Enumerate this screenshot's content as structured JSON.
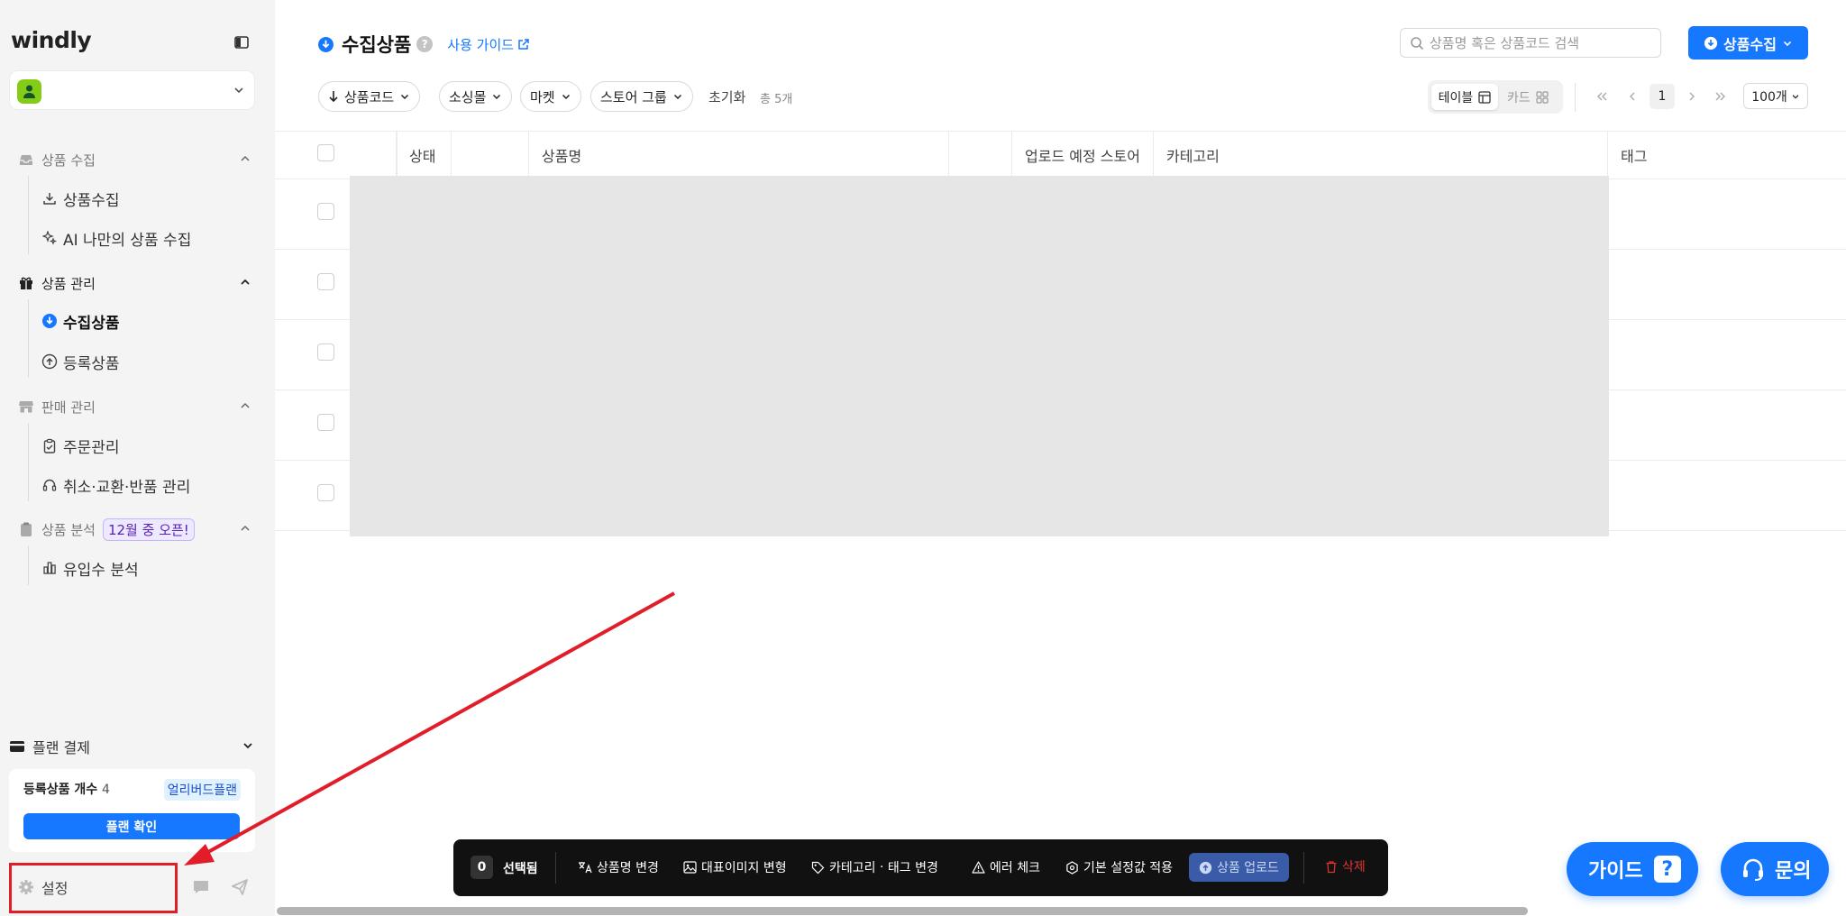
{
  "app": {
    "brand": "windly"
  },
  "sidebar": {
    "sections": [
      {
        "label": "상품 수집",
        "items": [
          {
            "label": "상품수집"
          },
          {
            "label": "AI 나만의 상품 수집"
          }
        ]
      },
      {
        "label": "상품 관리",
        "items": [
          {
            "label": "수집상품"
          },
          {
            "label": "등록상품"
          }
        ]
      },
      {
        "label": "판매 관리",
        "items": [
          {
            "label": "주문관리"
          },
          {
            "label": "취소·교환·반품 관리"
          }
        ]
      },
      {
        "label": "상품 분석",
        "badge": "12월 중 오픈!",
        "items": [
          {
            "label": "유입수 분석"
          }
        ]
      }
    ],
    "active_item": "수집상품",
    "plan": {
      "header": "플랜 결제",
      "count_label": "등록상품 개수",
      "count_value": "4",
      "plan_badge": "얼리버드플랜",
      "button": "플랜 확인"
    },
    "settings_label": "설정"
  },
  "header": {
    "title": "수집상품",
    "help": "?",
    "guide_link": "사용 가이드",
    "search_placeholder": "상품명 혹은 상품코드 검색",
    "collect_button": "상품수집"
  },
  "filters": {
    "sort": "상품코드",
    "source": "소싱몰",
    "market": "마켓",
    "store_group": "스토어 그룹",
    "reset": "초기화",
    "total": "총 5개"
  },
  "view": {
    "table": "테이블",
    "card": "카드",
    "active": "table"
  },
  "pagination": {
    "current": "1",
    "per_page": "100개"
  },
  "table": {
    "columns": {
      "status": "상태",
      "name": "상품명",
      "store": "업로드 예정 스토어",
      "category": "카테고리",
      "tag": "태그"
    },
    "row_count": 5
  },
  "actionbar": {
    "count": "0",
    "selected": "선택됨",
    "rename": "상품명 변경",
    "image": "대표이미지 변형",
    "category_tag_a": "카테고리",
    "category_tag_sep": "·",
    "category_tag_b": "태그 변경",
    "error_check": "에러 체크",
    "defaults": "기본 설정값 적용",
    "upload": "상품 업로드",
    "delete": "삭제"
  },
  "fab": {
    "guide": "가이드",
    "guide_icon": "?",
    "ask": "문의"
  },
  "colors": {
    "accent": "#1677ff",
    "annotation": "#e11d2a",
    "delete": "#e03131"
  }
}
